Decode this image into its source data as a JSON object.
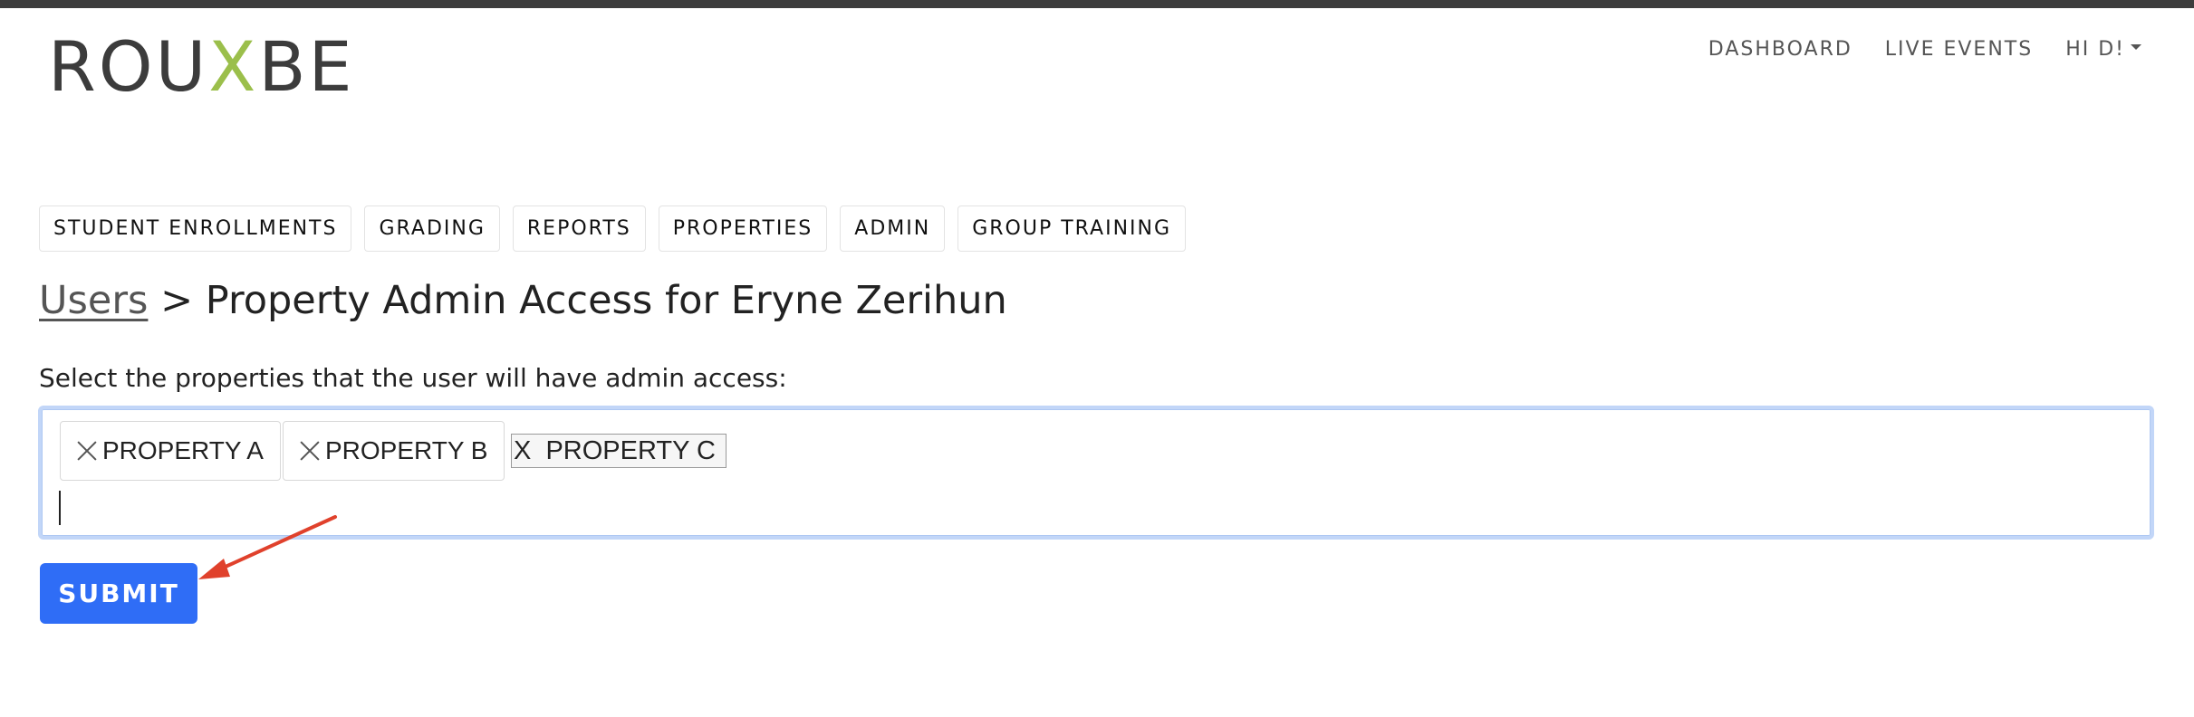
{
  "brand": {
    "logo_prefix": "ROU",
    "logo_accent": "X",
    "logo_suffix": "BE",
    "accent_color": "#9bbf4b"
  },
  "topnav": {
    "dashboard": "DASHBOARD",
    "live_events": "LIVE EVENTS",
    "user_menu": "HI D!"
  },
  "tabs": [
    {
      "label": "STUDENT ENROLLMENTS"
    },
    {
      "label": "GRADING"
    },
    {
      "label": "REPORTS"
    },
    {
      "label": "PROPERTIES"
    },
    {
      "label": "ADMIN"
    },
    {
      "label": "GROUP TRAINING"
    }
  ],
  "heading": {
    "breadcrumb_link": "Users",
    "separator": " > ",
    "title": "Property Admin Access for Eryne Zerihun"
  },
  "form": {
    "label": "Select the properties that the user will have admin access:",
    "selected": [
      {
        "label": "PROPERTY A"
      },
      {
        "label": "PROPERTY B"
      }
    ],
    "pending_chip": "X  PROPERTY C",
    "submit_label": "SUBMIT",
    "submit_color": "#2f6df6",
    "focus_ring_color": "#c2d6f8"
  },
  "annotation": {
    "arrow_color": "#e0412c"
  }
}
